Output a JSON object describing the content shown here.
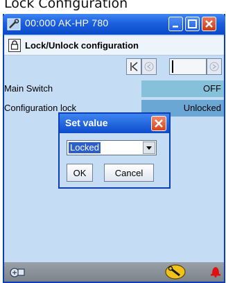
{
  "page": {
    "caption": "Lock Configuration"
  },
  "window": {
    "title": "00:000 AK-HP 780"
  },
  "header": {
    "title": "Lock/Unlock configuration"
  },
  "parameters": [
    {
      "label": "Main Switch",
      "value": "OFF"
    },
    {
      "label": "Configuration lock",
      "value": "Unlocked"
    }
  ],
  "dialog": {
    "title": "Set value",
    "selected_option": "Locked",
    "ok_label": "OK",
    "cancel_label": "Cancel"
  },
  "colors": {
    "titlebar": "#1b5fe0",
    "window_bg": "#c5dcf5",
    "value_cell": "#86c1dc",
    "alarm": "#e01010"
  },
  "icons": {
    "app": "wrench-icon",
    "lock": "padlock-icon",
    "status_left": "network-icon",
    "status_service": "wrench-icon",
    "status_alarm": "alarm-bell-icon"
  }
}
